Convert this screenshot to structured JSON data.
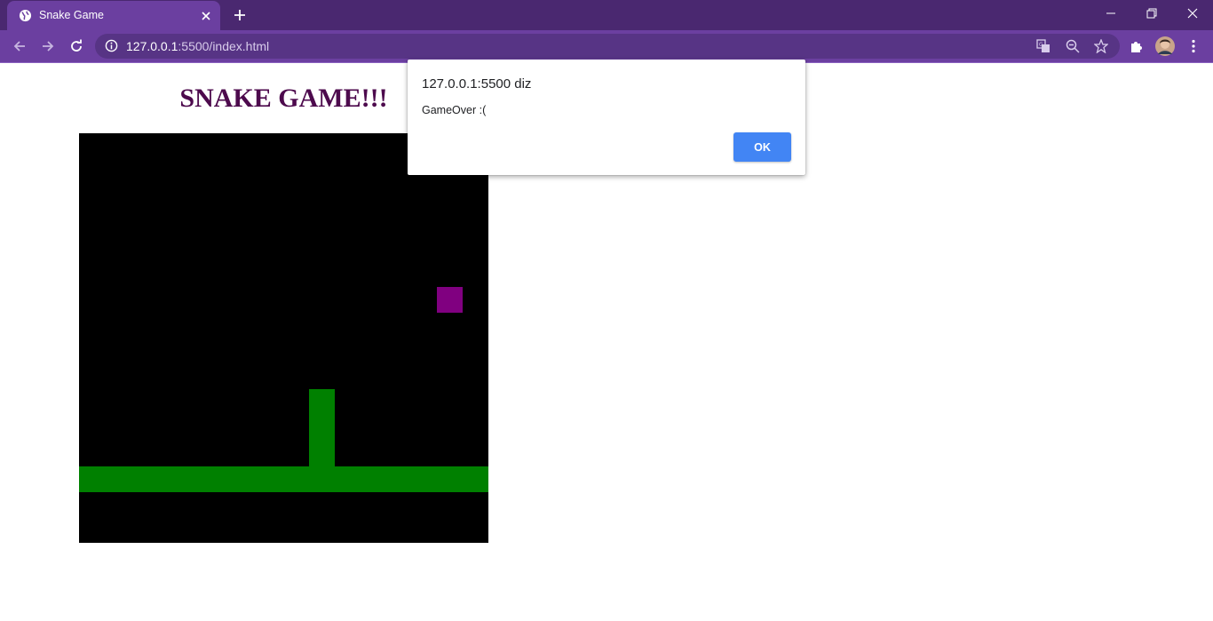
{
  "browser": {
    "tab": {
      "title": "Snake Game",
      "favicon": "globe-icon"
    },
    "new_tab_icon": "plus-icon",
    "window_controls": [
      "minimize-icon",
      "restore-icon",
      "close-icon"
    ],
    "address_bar": {
      "url_host": "127.0.0.1",
      "url_rest": ":5500/index.html",
      "security_icon": "info-icon"
    },
    "toolbar_icons": [
      "back-arrow-icon",
      "forward-arrow-icon",
      "reload-icon",
      "translate-icon",
      "zoom-out-icon",
      "bookmark-star-icon",
      "extensions-puzzle-icon",
      "profile-avatar",
      "menu-dots-icon"
    ],
    "colors": {
      "frame": "#4a2870",
      "toolbar": "#6b3fa0",
      "omnibox": "#573485"
    }
  },
  "page": {
    "title": "SNAKE GAME!!!",
    "title_color": "#4d0a4d",
    "game": {
      "board_color": "#000000",
      "snake_color": "#008000",
      "food_color": "#800080",
      "grid_columns": 16,
      "grid_rows": 16,
      "snake_cells": [
        [
          0,
          13
        ],
        [
          1,
          13
        ],
        [
          2,
          13
        ],
        [
          3,
          13
        ],
        [
          4,
          13
        ],
        [
          5,
          13
        ],
        [
          6,
          13
        ],
        [
          7,
          13
        ],
        [
          8,
          13
        ],
        [
          9,
          13
        ],
        [
          10,
          13
        ],
        [
          11,
          13
        ],
        [
          12,
          13
        ],
        [
          13,
          13
        ],
        [
          14,
          13
        ],
        [
          15,
          13
        ],
        [
          9,
          10
        ],
        [
          9,
          11
        ],
        [
          9,
          12
        ]
      ],
      "food_cell": [
        14,
        6
      ]
    }
  },
  "dialog": {
    "origin": "127.0.0.1:5500 diz",
    "message": "GameOver :(",
    "ok_label": "OK",
    "ok_color": "#4285f4"
  }
}
